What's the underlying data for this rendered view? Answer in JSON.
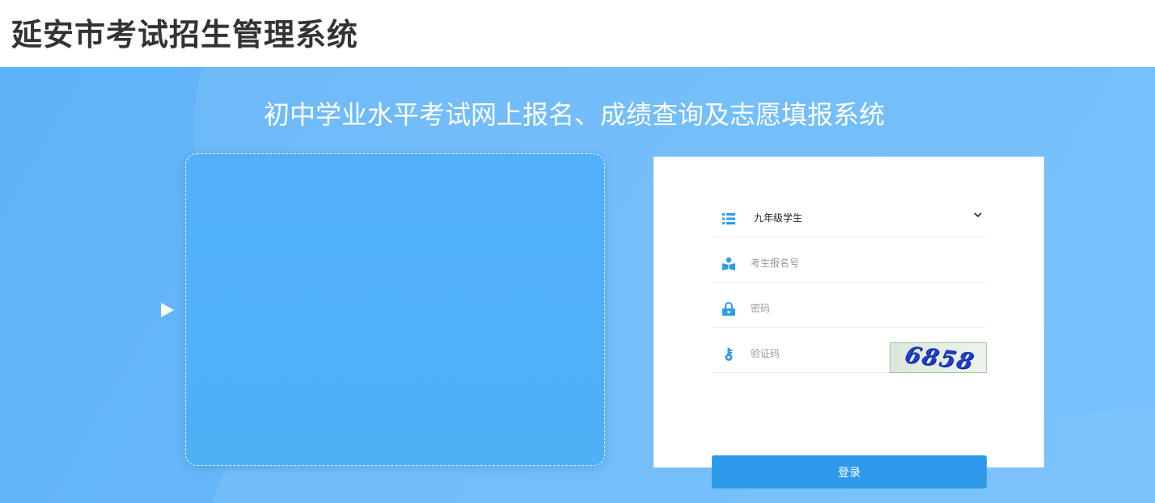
{
  "header": {
    "title": "延安市考试招生管理系统"
  },
  "hero": {
    "subtitle": "初中学业水平考试网上报名、成绩查询及志愿填报系统"
  },
  "login": {
    "role_select": {
      "value": "九年级学生",
      "icon": "list-icon"
    },
    "exam_id": {
      "placeholder": "考生报名号",
      "icon": "user-book-icon"
    },
    "password": {
      "placeholder": "密码",
      "icon": "lock-icon"
    },
    "captcha": {
      "placeholder": "验证码",
      "icon": "key-icon",
      "image_text": "6858"
    },
    "submit_label": "登录"
  },
  "colors": {
    "accent": "#2e9bea",
    "hero_bg": "#68b8fa",
    "icon": "#2f9ce8"
  }
}
